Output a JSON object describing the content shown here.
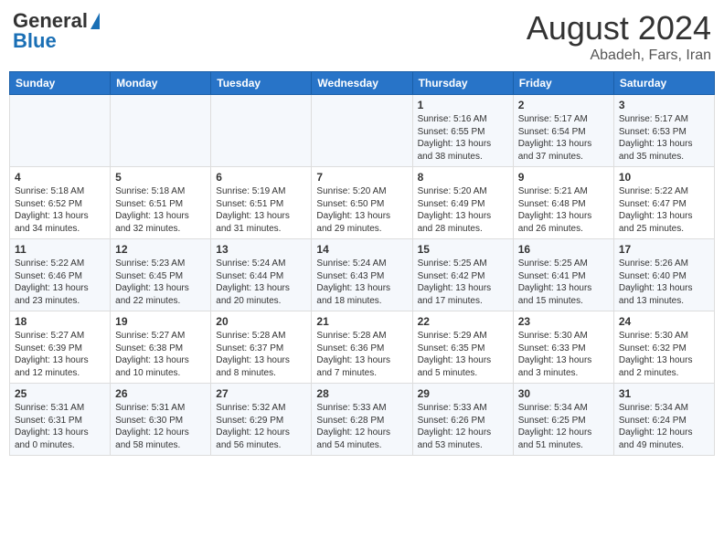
{
  "header": {
    "logo_general": "General",
    "logo_blue": "Blue",
    "month_year": "August 2024",
    "location": "Abadeh, Fars, Iran"
  },
  "weekdays": [
    "Sunday",
    "Monday",
    "Tuesday",
    "Wednesday",
    "Thursday",
    "Friday",
    "Saturday"
  ],
  "weeks": [
    [
      {
        "day": "",
        "info": ""
      },
      {
        "day": "",
        "info": ""
      },
      {
        "day": "",
        "info": ""
      },
      {
        "day": "",
        "info": ""
      },
      {
        "day": "1",
        "info": "Sunrise: 5:16 AM\nSunset: 6:55 PM\nDaylight: 13 hours\nand 38 minutes."
      },
      {
        "day": "2",
        "info": "Sunrise: 5:17 AM\nSunset: 6:54 PM\nDaylight: 13 hours\nand 37 minutes."
      },
      {
        "day": "3",
        "info": "Sunrise: 5:17 AM\nSunset: 6:53 PM\nDaylight: 13 hours\nand 35 minutes."
      }
    ],
    [
      {
        "day": "4",
        "info": "Sunrise: 5:18 AM\nSunset: 6:52 PM\nDaylight: 13 hours\nand 34 minutes."
      },
      {
        "day": "5",
        "info": "Sunrise: 5:18 AM\nSunset: 6:51 PM\nDaylight: 13 hours\nand 32 minutes."
      },
      {
        "day": "6",
        "info": "Sunrise: 5:19 AM\nSunset: 6:51 PM\nDaylight: 13 hours\nand 31 minutes."
      },
      {
        "day": "7",
        "info": "Sunrise: 5:20 AM\nSunset: 6:50 PM\nDaylight: 13 hours\nand 29 minutes."
      },
      {
        "day": "8",
        "info": "Sunrise: 5:20 AM\nSunset: 6:49 PM\nDaylight: 13 hours\nand 28 minutes."
      },
      {
        "day": "9",
        "info": "Sunrise: 5:21 AM\nSunset: 6:48 PM\nDaylight: 13 hours\nand 26 minutes."
      },
      {
        "day": "10",
        "info": "Sunrise: 5:22 AM\nSunset: 6:47 PM\nDaylight: 13 hours\nand 25 minutes."
      }
    ],
    [
      {
        "day": "11",
        "info": "Sunrise: 5:22 AM\nSunset: 6:46 PM\nDaylight: 13 hours\nand 23 minutes."
      },
      {
        "day": "12",
        "info": "Sunrise: 5:23 AM\nSunset: 6:45 PM\nDaylight: 13 hours\nand 22 minutes."
      },
      {
        "day": "13",
        "info": "Sunrise: 5:24 AM\nSunset: 6:44 PM\nDaylight: 13 hours\nand 20 minutes."
      },
      {
        "day": "14",
        "info": "Sunrise: 5:24 AM\nSunset: 6:43 PM\nDaylight: 13 hours\nand 18 minutes."
      },
      {
        "day": "15",
        "info": "Sunrise: 5:25 AM\nSunset: 6:42 PM\nDaylight: 13 hours\nand 17 minutes."
      },
      {
        "day": "16",
        "info": "Sunrise: 5:25 AM\nSunset: 6:41 PM\nDaylight: 13 hours\nand 15 minutes."
      },
      {
        "day": "17",
        "info": "Sunrise: 5:26 AM\nSunset: 6:40 PM\nDaylight: 13 hours\nand 13 minutes."
      }
    ],
    [
      {
        "day": "18",
        "info": "Sunrise: 5:27 AM\nSunset: 6:39 PM\nDaylight: 13 hours\nand 12 minutes."
      },
      {
        "day": "19",
        "info": "Sunrise: 5:27 AM\nSunset: 6:38 PM\nDaylight: 13 hours\nand 10 minutes."
      },
      {
        "day": "20",
        "info": "Sunrise: 5:28 AM\nSunset: 6:37 PM\nDaylight: 13 hours\nand 8 minutes."
      },
      {
        "day": "21",
        "info": "Sunrise: 5:28 AM\nSunset: 6:36 PM\nDaylight: 13 hours\nand 7 minutes."
      },
      {
        "day": "22",
        "info": "Sunrise: 5:29 AM\nSunset: 6:35 PM\nDaylight: 13 hours\nand 5 minutes."
      },
      {
        "day": "23",
        "info": "Sunrise: 5:30 AM\nSunset: 6:33 PM\nDaylight: 13 hours\nand 3 minutes."
      },
      {
        "day": "24",
        "info": "Sunrise: 5:30 AM\nSunset: 6:32 PM\nDaylight: 13 hours\nand 2 minutes."
      }
    ],
    [
      {
        "day": "25",
        "info": "Sunrise: 5:31 AM\nSunset: 6:31 PM\nDaylight: 13 hours\nand 0 minutes."
      },
      {
        "day": "26",
        "info": "Sunrise: 5:31 AM\nSunset: 6:30 PM\nDaylight: 12 hours\nand 58 minutes."
      },
      {
        "day": "27",
        "info": "Sunrise: 5:32 AM\nSunset: 6:29 PM\nDaylight: 12 hours\nand 56 minutes."
      },
      {
        "day": "28",
        "info": "Sunrise: 5:33 AM\nSunset: 6:28 PM\nDaylight: 12 hours\nand 54 minutes."
      },
      {
        "day": "29",
        "info": "Sunrise: 5:33 AM\nSunset: 6:26 PM\nDaylight: 12 hours\nand 53 minutes."
      },
      {
        "day": "30",
        "info": "Sunrise: 5:34 AM\nSunset: 6:25 PM\nDaylight: 12 hours\nand 51 minutes."
      },
      {
        "day": "31",
        "info": "Sunrise: 5:34 AM\nSunset: 6:24 PM\nDaylight: 12 hours\nand 49 minutes."
      }
    ]
  ]
}
